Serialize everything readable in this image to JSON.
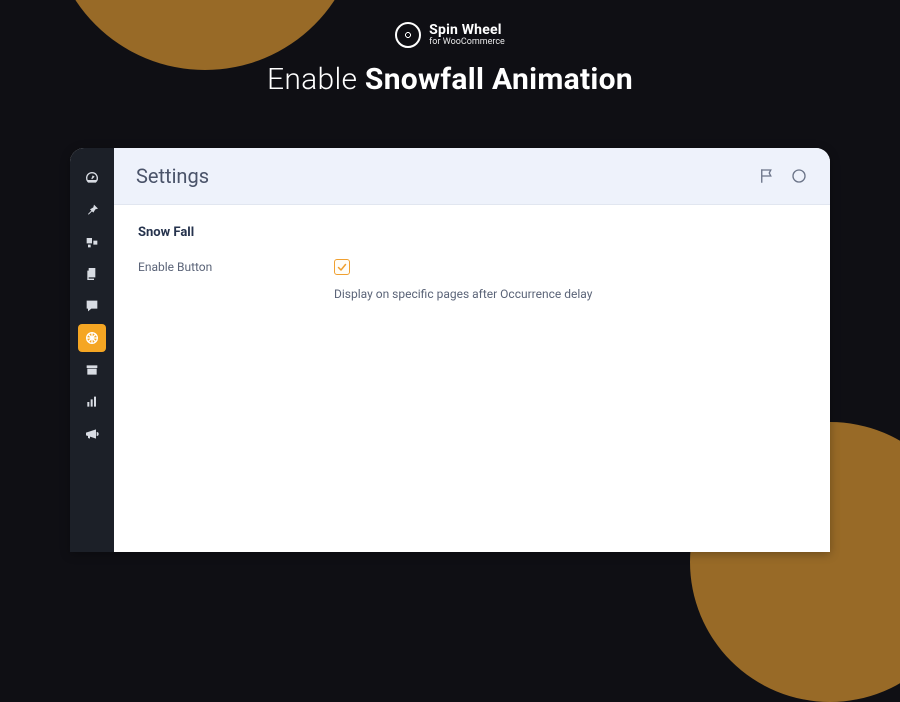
{
  "brand": {
    "title": "Spin Wheel",
    "subtitle": "for WooCommerce"
  },
  "hero": {
    "title_light": "Enable ",
    "title_bold": "Snowfall Animation"
  },
  "sidebar": {
    "items": [
      {
        "name": "dashboard"
      },
      {
        "name": "pin"
      },
      {
        "name": "media"
      },
      {
        "name": "pages"
      },
      {
        "name": "comments"
      },
      {
        "name": "spinwheel",
        "active": true
      },
      {
        "name": "archive"
      },
      {
        "name": "analytics"
      },
      {
        "name": "marketing"
      }
    ]
  },
  "header": {
    "title": "Settings"
  },
  "settings": {
    "section_title": "Snow Fall",
    "enable_label": "Enable Button",
    "enable_checked": true,
    "enable_description": "Display on specific pages after Occurrence delay"
  }
}
